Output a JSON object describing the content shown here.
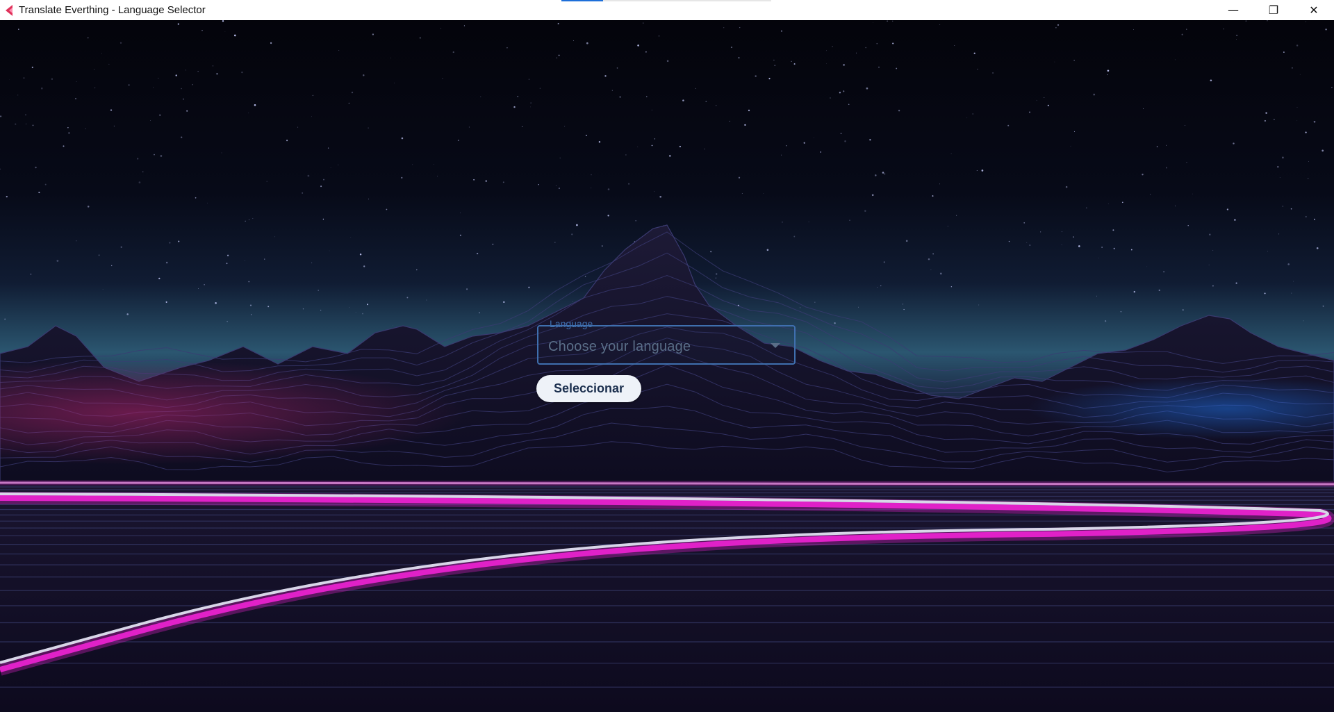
{
  "window": {
    "title": "Translate Everthing - Language Selector",
    "minimize_glyph": "—",
    "maximize_glyph": "❐",
    "close_glyph": "✕"
  },
  "form": {
    "language_label": "Language",
    "language_placeholder": "Choose your language",
    "select_button_label": "Seleccionar"
  },
  "colors": {
    "accent": "#3f6fae",
    "neon_pink": "#e021c8",
    "sky_top": "#05050d",
    "sky_horizon": "#2f5a72",
    "ground": "#140f2a"
  },
  "icons": {
    "app": "app-logo-icon",
    "dropdown": "chevron-down-icon",
    "minimize": "minimize-icon",
    "maximize": "restore-icon",
    "close": "close-icon"
  }
}
